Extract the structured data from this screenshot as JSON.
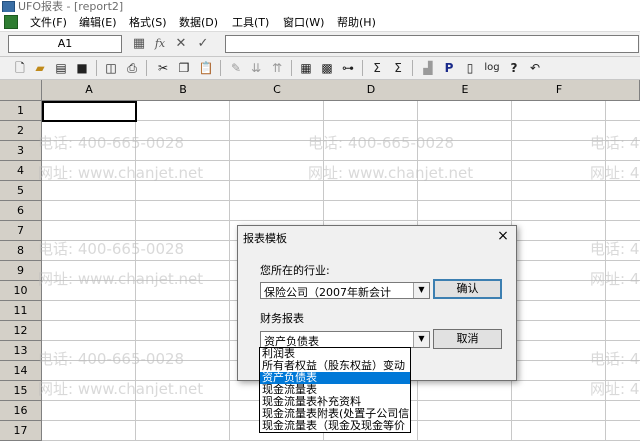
{
  "window": {
    "title": "UFO报表 - [report2]"
  },
  "menu": [
    "文件(F)",
    "编辑(E)",
    "格式(S)",
    "数据(D)",
    "工具(T)",
    "窗口(W)",
    "帮助(H)"
  ],
  "formula_bar": {
    "cell_ref": "A1",
    "fx_label": "fx",
    "formula_value": ""
  },
  "sheet": {
    "columns": [
      "A",
      "B",
      "C",
      "D",
      "E",
      "F"
    ],
    "rows": [
      "1",
      "2",
      "3",
      "4",
      "5",
      "6",
      "7",
      "8",
      "9",
      "10",
      "11",
      "12",
      "13",
      "14",
      "15",
      "16",
      "17"
    ]
  },
  "watermark": {
    "phone": "电话: 400-665-0028",
    "site": "网址: www.chanjet.net",
    "phone_short": "电话: 4",
    "site_short": "网址: 4"
  },
  "dialog": {
    "title": "报表模板",
    "close_glyph": "×",
    "industry_label": "您所在的行业:",
    "industry_value": "保险公司（2007年新会计",
    "report_label": "财务报表",
    "report_value": "资产负债表",
    "ok_label": "确认",
    "cancel_label": "取消",
    "options": [
      "利润表",
      "所有者权益（股东权益）变动",
      "资产负债表",
      "现金流量表",
      "现金流量表补充资料",
      "现金流量表附表(处置子公司信",
      "现金流量表（现金及现金等价"
    ],
    "selected_index": 2
  }
}
